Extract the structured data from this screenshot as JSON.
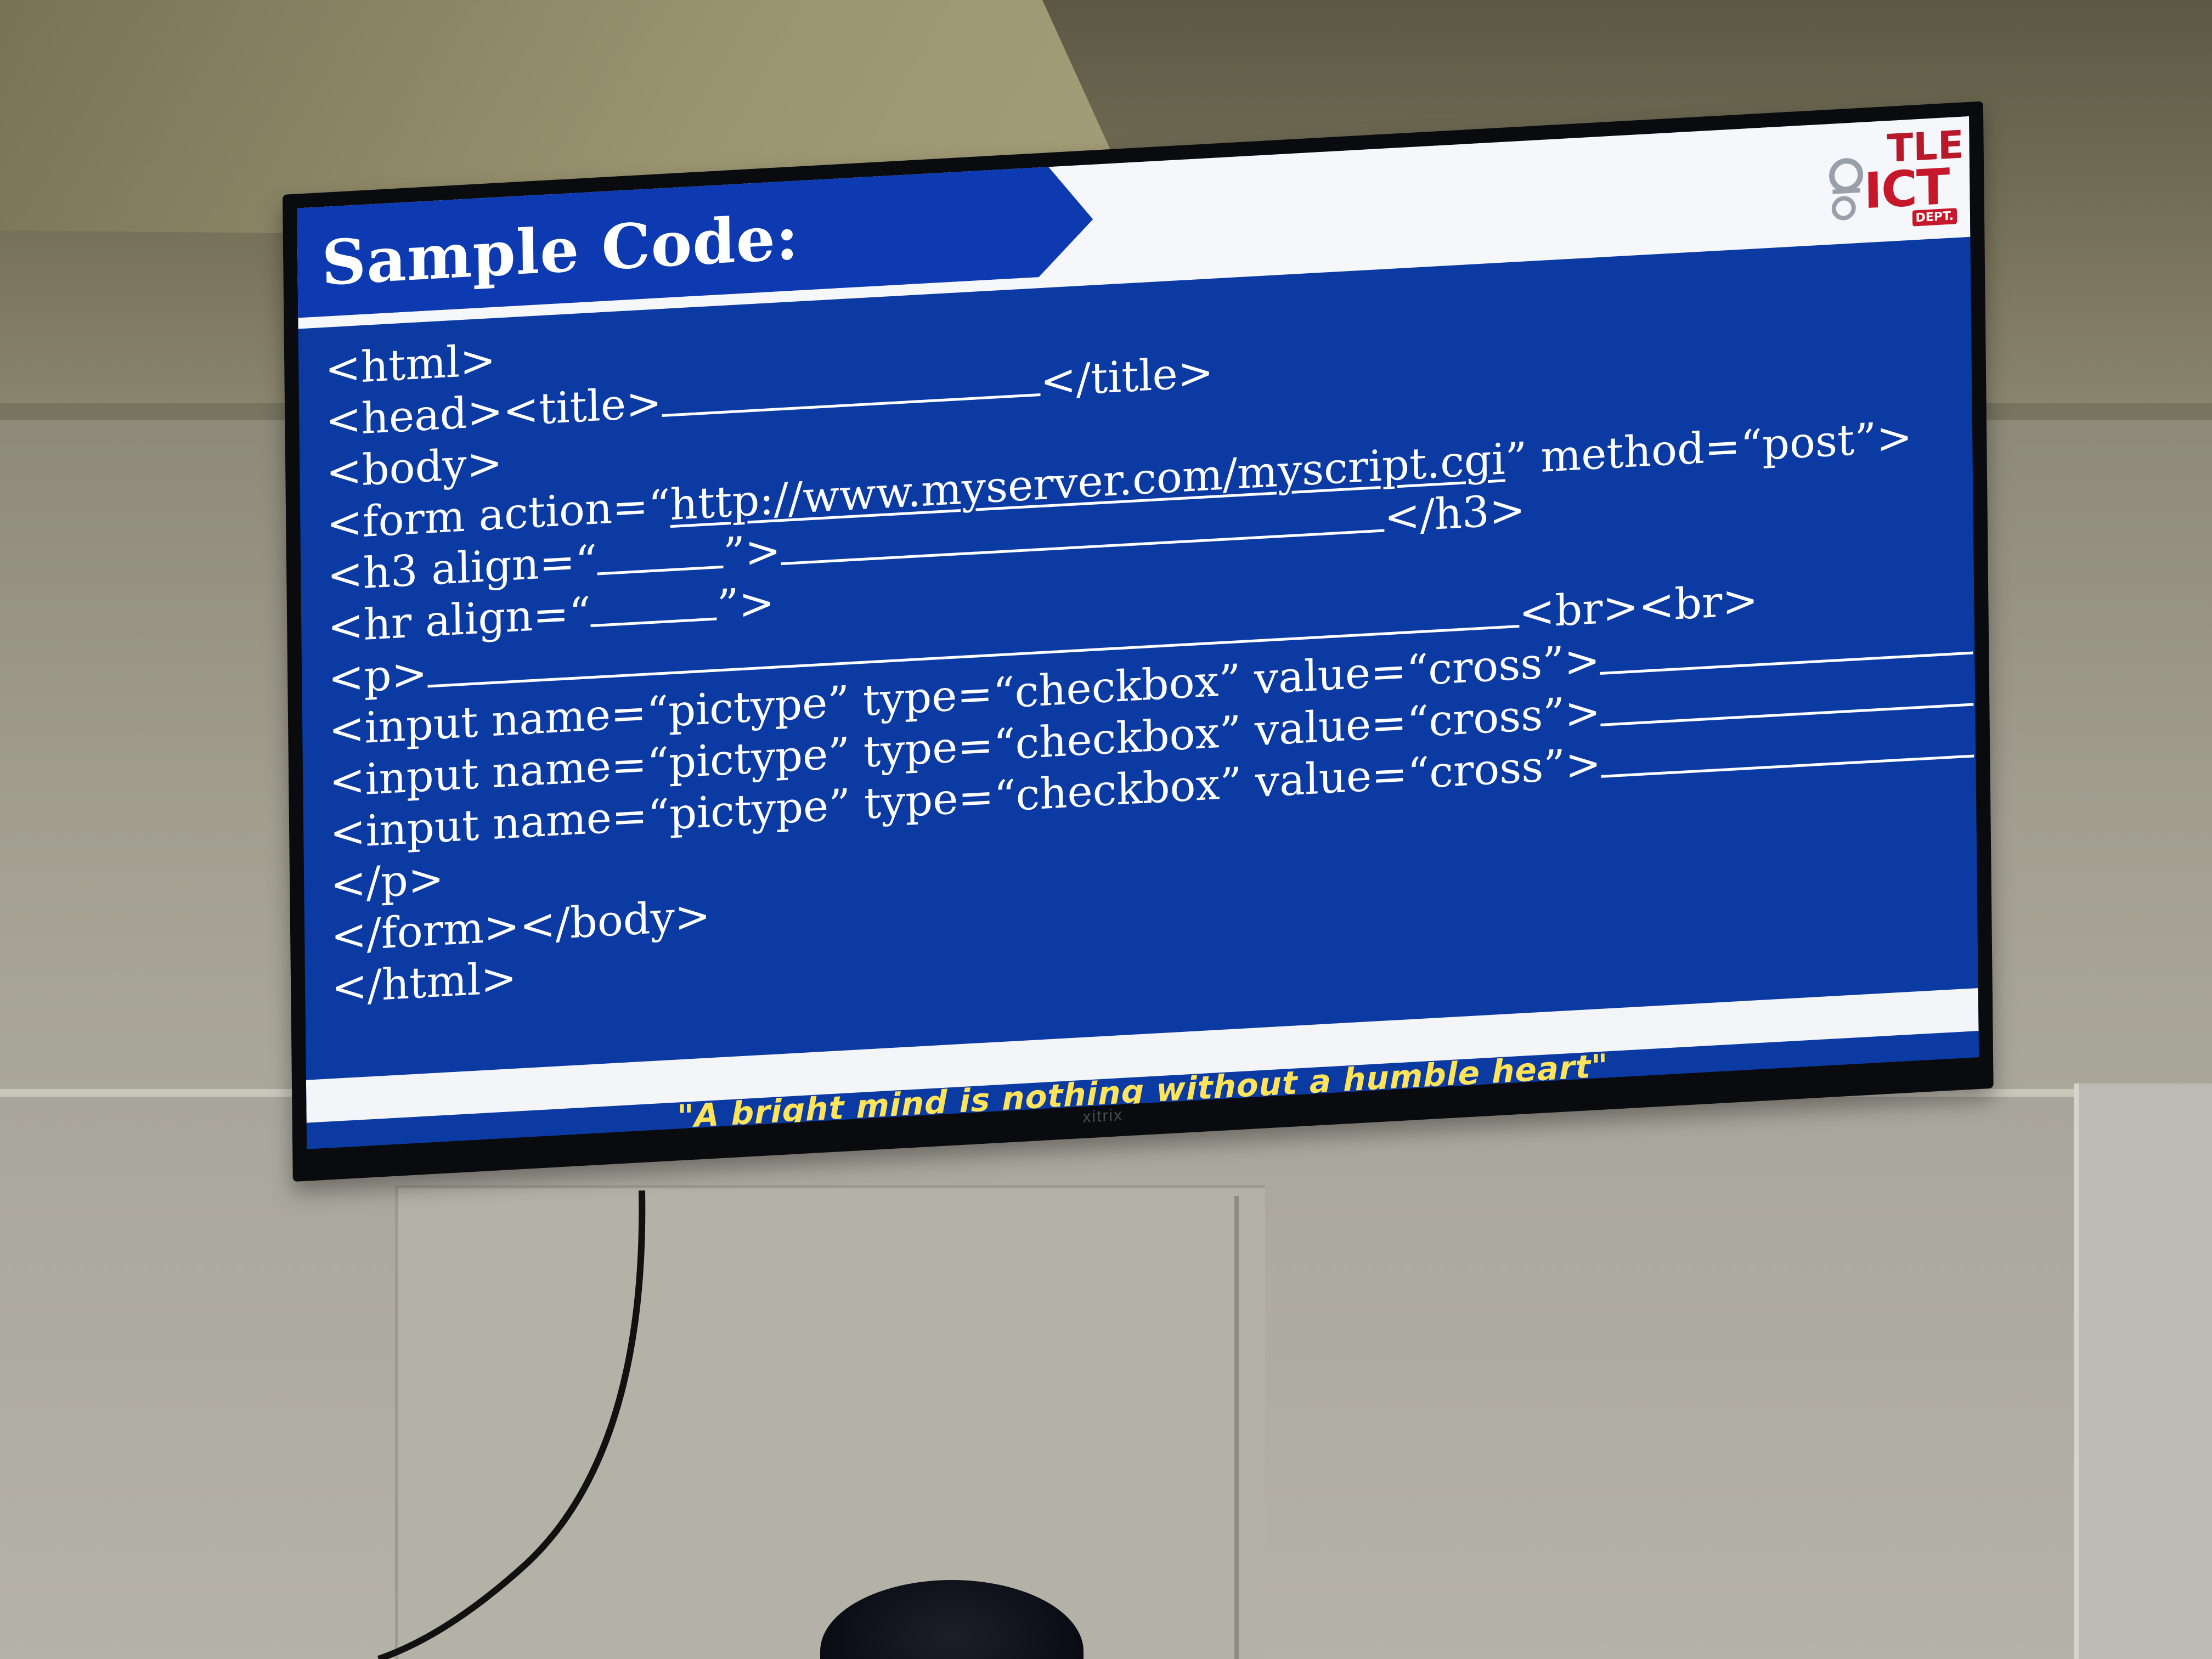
{
  "slide": {
    "title": "Sample Code:",
    "logo": {
      "line1": "TLE",
      "line2": "ICT",
      "line3": "DEPT."
    },
    "code": {
      "line1": "<html>",
      "line2a": "<head><title>",
      "line2b": "</title>",
      "line3": "<body>",
      "line4a": "<form action=“",
      "line4_url": "http://www.myserver.com/myscript.cgi",
      "line4b": "” method=“post”>",
      "line5a": "<h3 align=“",
      "line5b": "”>",
      "line5c": "</h3>",
      "line6a": "<hr align=“",
      "line6b": "”>",
      "line7a": "<p>",
      "line7b": "<br><br>",
      "input_line": "<input name=“pictype” type=“checkbox” value=“cross”>",
      "line11": "</p>",
      "line12": "</form></body>",
      "line13": "</html>"
    },
    "quote": "\"A bright mind is nothing without a humble heart\""
  },
  "tv": {
    "brand": "xitrix"
  },
  "colors": {
    "slide_blue": "#0b3aa3",
    "quote_yellow": "#ffe45a",
    "logo_red": "#c6172b"
  }
}
